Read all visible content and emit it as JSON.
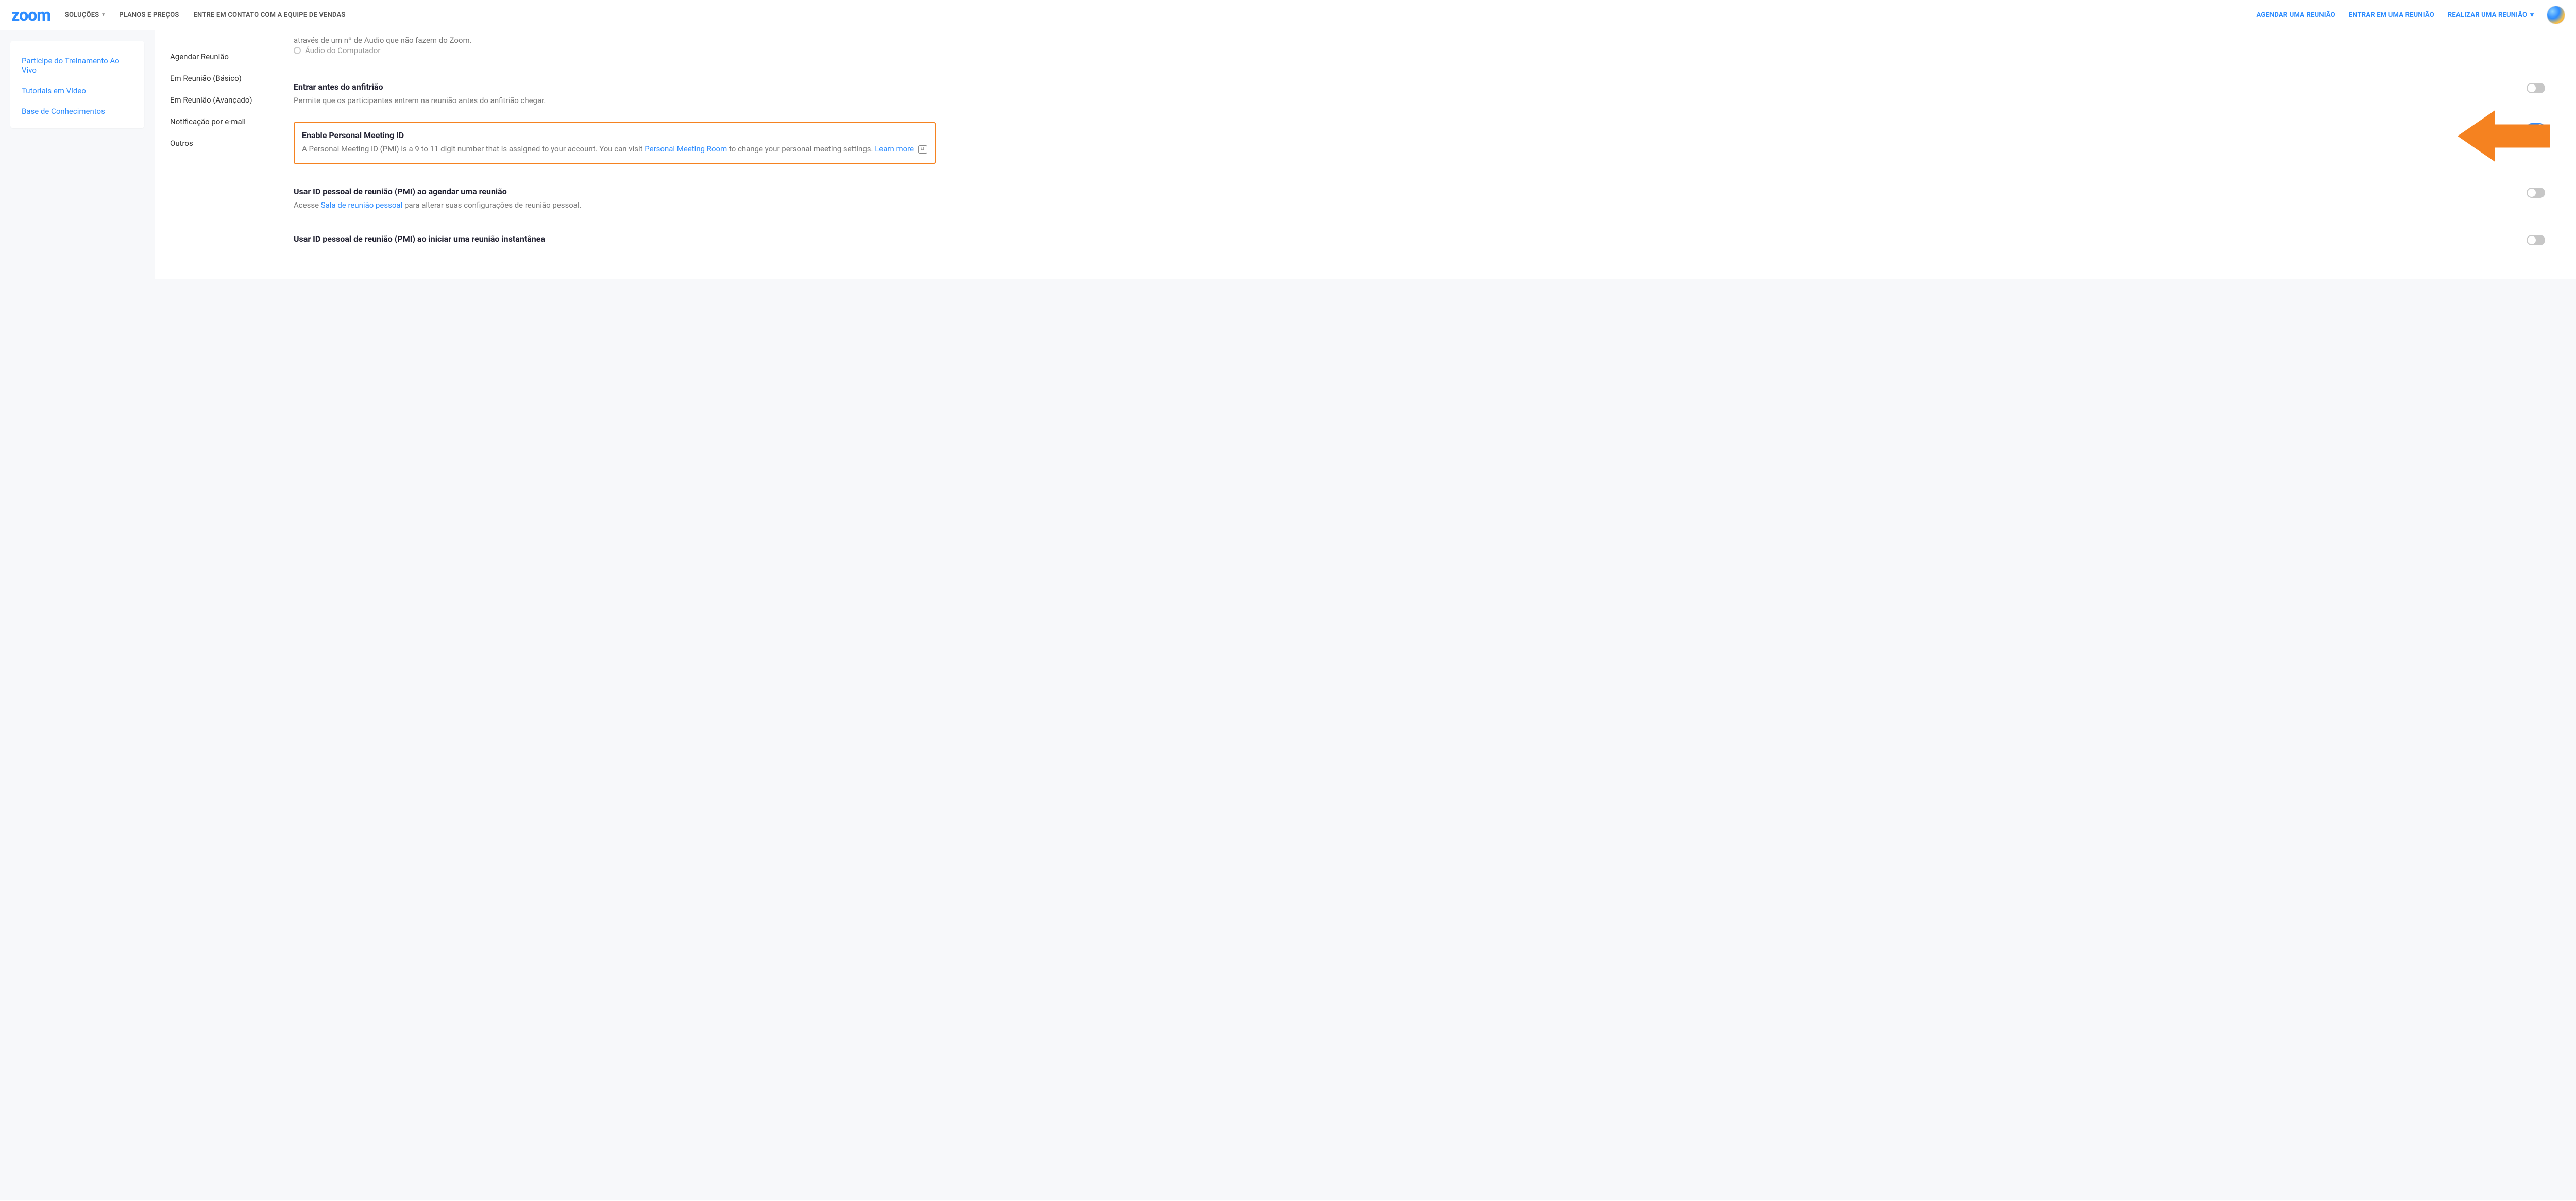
{
  "header": {
    "logo_text": "zoom",
    "nav": {
      "solutions": "SOLUÇÕES",
      "plans": "PLANOS E PREÇOS",
      "contact_sales": "ENTRE EM CONTATO COM A EQUIPE DE VENDAS"
    },
    "cta": {
      "schedule": "AGENDAR UMA REUNIÃO",
      "join": "ENTRAR EM UMA REUNIÃO",
      "host": "REALIZAR UMA REUNIÃO"
    }
  },
  "sidebar": {
    "training": "Participe do Treinamento Ao Vivo",
    "tutorials": "Tutoriais em Vídeo",
    "knowledge": "Base de Conhecimentos"
  },
  "subnav": {
    "schedule": "Agendar Reunião",
    "in_meeting_basic": "Em Reunião (Básico)",
    "in_meeting_adv": "Em Reunião (Avançado)",
    "email_notif": "Notificação por e-mail",
    "others": "Outros"
  },
  "settings": {
    "cut_line": "através de um nº de Audio que não fazem do Zoom.",
    "ghost_radio": "Áudio do Computador",
    "join_before_host": {
      "title": "Entrar antes do anfitrião",
      "desc": "Permite que os participantes entrem na reunião antes do anfitrião chegar."
    },
    "enable_pmi": {
      "title": "Enable Personal Meeting ID",
      "desc_a": "A Personal Meeting ID (PMI) is a 9 to 11 digit number that is assigned to your account. You can visit ",
      "link1": "Personal Meeting Room",
      "desc_b": " to change your personal meeting settings. ",
      "link2": "Learn more",
      "badge": "⧉"
    },
    "use_pmi_schedule": {
      "title": "Usar ID pessoal de reunião (PMI) ao agendar uma reunião",
      "desc_a": "Acesse ",
      "link": "Sala de reunião pessoal",
      "desc_b": " para alterar suas configurações de reunião pessoal."
    },
    "use_pmi_instant": {
      "title": "Usar ID pessoal de reunião (PMI) ao iniciar uma reunião instantânea"
    }
  },
  "colors": {
    "accent": "#2d8cff",
    "arrow": "#f58220"
  }
}
